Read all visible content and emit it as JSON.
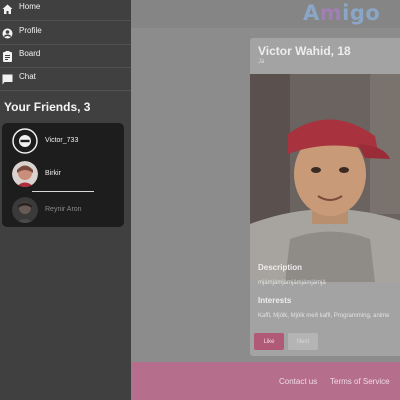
{
  "app": {
    "logo_text_a": "A",
    "logo_text_m": "m",
    "logo_text_rest": "igo"
  },
  "nav": {
    "items": [
      {
        "label": "Home",
        "icon": "home-icon"
      },
      {
        "label": "Profile",
        "icon": "account-circle-icon"
      },
      {
        "label": "Board",
        "icon": "clipboard-icon"
      },
      {
        "label": "Chat",
        "icon": "chat-bubble-icon"
      }
    ]
  },
  "friends": {
    "title": "Your Friends, 3",
    "list": [
      {
        "name": "Victor_733",
        "avatar": "blocked-avatar-icon"
      },
      {
        "name": "Birkir",
        "avatar": "avatar-photo"
      },
      {
        "name": "Reynir Aron",
        "avatar": "avatar-photo"
      }
    ]
  },
  "profile_card": {
    "name": "Victor Wahid, 18",
    "subtitle": "Já",
    "description_heading": "Description",
    "description_text": "mjámjámjámjámjámjámjá",
    "interests_heading": "Interests",
    "interests_text": "Kaffi, Mjólk, Mjólk með kaffi, Programming, anime",
    "like_label": "Like",
    "next_label": "Next"
  },
  "footer": {
    "contact_label": "Contact us",
    "terms_label": "Terms of Service"
  },
  "colors": {
    "sidebar_bg": "#404040",
    "friends_box_bg": "#1d1d1d",
    "footer_bg": "#b56e8c",
    "like_button": "#b05a78",
    "logo_blue": "#8aa6c6",
    "logo_purple": "#a07fb3"
  }
}
